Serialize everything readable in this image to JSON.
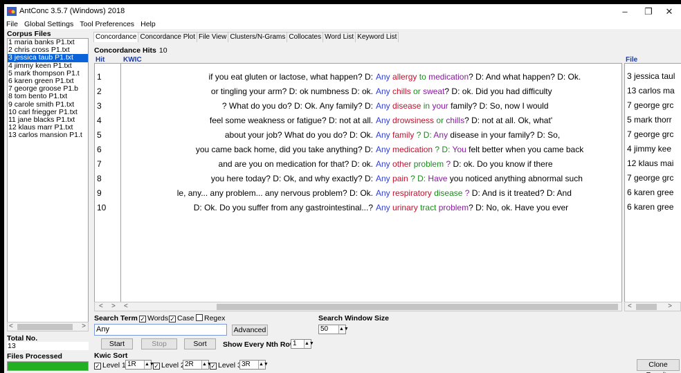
{
  "window": {
    "title": "AntConc 3.5.7 (Windows) 2018",
    "minimize": "–",
    "restore": "❐",
    "close": "✕"
  },
  "menu": [
    "File",
    "Global Settings",
    "Tool Preferences",
    "Help"
  ],
  "left_panel": {
    "corpus_files_label": "Corpus Files",
    "files": [
      "1 maria banks P1.txt",
      "2 chris cross P1.txt",
      "3 jessica taub P1.txt",
      "4 jimmy keen P1.txt",
      "5 mark thompson P1.t",
      "6 karen green P1.txt",
      "7 george groose P1.b",
      "8 tom bento P1.txt",
      "9 carole smith P1.txt",
      "10 carl friegger P1.txt",
      "11 jane blacks P1.txt",
      "12 klaus marr P1.txt",
      "13 carlos mansion P1.t"
    ],
    "selected_index": 2,
    "total_no_label": "Total No.",
    "total_no_value": "13",
    "files_processed_label": "Files Processed",
    "progress": 1.0
  },
  "tabs": [
    "Concordance",
    "Concordance Plot",
    "File View",
    "Clusters/N-Grams",
    "Collocates",
    "Word List",
    "Keyword List"
  ],
  "active_tab": 0,
  "concordance": {
    "hits_label": "Concordance Hits",
    "hits_value": "10",
    "col_hit": "Hit",
    "col_kwic": "KWIC",
    "col_file": "File",
    "rows": [
      {
        "n": "1",
        "left": "if you eat gluten or lactose, what happen? D:",
        "kw": "Any",
        "r1": "allergy",
        "r2": "to",
        "r3": "medication",
        "rest": "? D: And what happen? D: Ok.",
        "file": "3 jessica taul"
      },
      {
        "n": "2",
        "left": "or tingling your arm? D: ok numbness D: ok.",
        "kw": "Any",
        "r1": "chills",
        "r2": "or",
        "r3": "sweat",
        "rest": "? D: ok. Did you had difficulty",
        "file": "13 carlos ma"
      },
      {
        "n": "3",
        "left": "? What do you do? D: Ok. Any family? D:",
        "kw": "Any",
        "r1": "disease",
        "r2": "in",
        "r3": "your",
        "rest": " family? D: So, now I would",
        "file": "7 george grc"
      },
      {
        "n": "4",
        "left": "feel some weakness or fatigue? D: not at all.",
        "kw": "Any",
        "r1": "drowsiness",
        "r2": "or",
        "r3": "chills",
        "rest": "? D: not at all. Ok, what'",
        "file": "5 mark thorr"
      },
      {
        "n": "5",
        "left": "about your job? What do you do? D: Ok.",
        "kw": "Any",
        "r1": "family",
        "r2": "? D:",
        "r3": "Any",
        "rest": " disease in your family? D: So,",
        "file": "7 george grc"
      },
      {
        "n": "6",
        "left": "you came back home, did you take anything? D:",
        "kw": "Any",
        "r1": "medication",
        "r2": "? D:",
        "r3": "You",
        "rest": " felt better when you came back",
        "file": "4 jimmy kee"
      },
      {
        "n": "7",
        "left": "and are you on medication for that? D: ok.",
        "kw": "Any",
        "r1": "other",
        "r2": "problem",
        "r3": "?",
        "rest": " D: ok. Do you know if there",
        "file": "12 klaus mai"
      },
      {
        "n": "8",
        "left": "you here today? D: Ok, and why exactly? D:",
        "kw": "Any",
        "r1": "pain",
        "r2": "? D:",
        "r3": "Have",
        "rest": " you noticed anything abnormal such",
        "file": "7 george grc"
      },
      {
        "n": "9",
        "left": "le, any... any problem... any nervous problem? D: Ok.",
        "kw": "Any",
        "r1": "respiratory",
        "r2": "disease",
        "r3": "?",
        "rest": " D: And is it treated? D: And",
        "file": "6 karen gree"
      },
      {
        "n": "10",
        "left": "D: Ok. Do you suffer from any gastrointestinal...?",
        "kw": "Any",
        "r1": "urinary",
        "r2": "tract",
        "r3": "problem",
        "rest": "? D: No, ok. Have you ever",
        "file": "6 karen gree"
      }
    ]
  },
  "search": {
    "term_label": "Search Term",
    "words_label": "Words",
    "case_label": "Case",
    "regex_label": "Regex",
    "words_checked": true,
    "case_checked": true,
    "regex_checked": false,
    "term_value": "Any",
    "advanced_label": "Advanced",
    "window_size_label": "Search Window Size",
    "window_size_value": "50",
    "start_label": "Start",
    "stop_label": "Stop",
    "sort_label": "Sort",
    "nth_row_label": "Show Every Nth Row",
    "nth_row_value": "1",
    "kwic_sort_label": "Kwic Sort",
    "level1_label": "Level 1",
    "level1_value": "1R",
    "level2_label": "Level 2",
    "level2_value": "2R",
    "level3_label": "Level 3",
    "level3_value": "3R",
    "clone_label": "Clone Results"
  },
  "colors": {
    "keyword": "#2f3ed8",
    "r1": "#c0102c",
    "r2": "#1a8a1a",
    "r3": "#8a1aa0",
    "selection": "#0a64d8",
    "progress": "#22b022"
  }
}
